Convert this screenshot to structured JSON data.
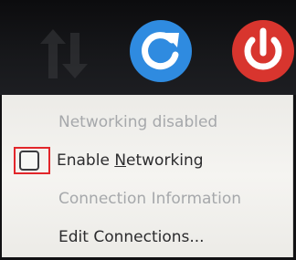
{
  "tray": {
    "icons": [
      {
        "name": "network-disconnected-icon"
      },
      {
        "name": "refresh-icon",
        "color": "#2f8be0"
      },
      {
        "name": "power-icon",
        "color": "#d8352e"
      }
    ]
  },
  "menu": {
    "status_label": "Networking disabled",
    "enable_label_pre": "Enable ",
    "enable_label_mnemonic": "N",
    "enable_label_post": "etworking",
    "enable_checked": false,
    "connection_info_label": "Connection Information",
    "edit_connections_label": "Edit Connections..."
  },
  "colors": {
    "disabled_text": "#a6a8ab",
    "active_text": "#2c2c2e",
    "highlight": "#e2262b"
  }
}
